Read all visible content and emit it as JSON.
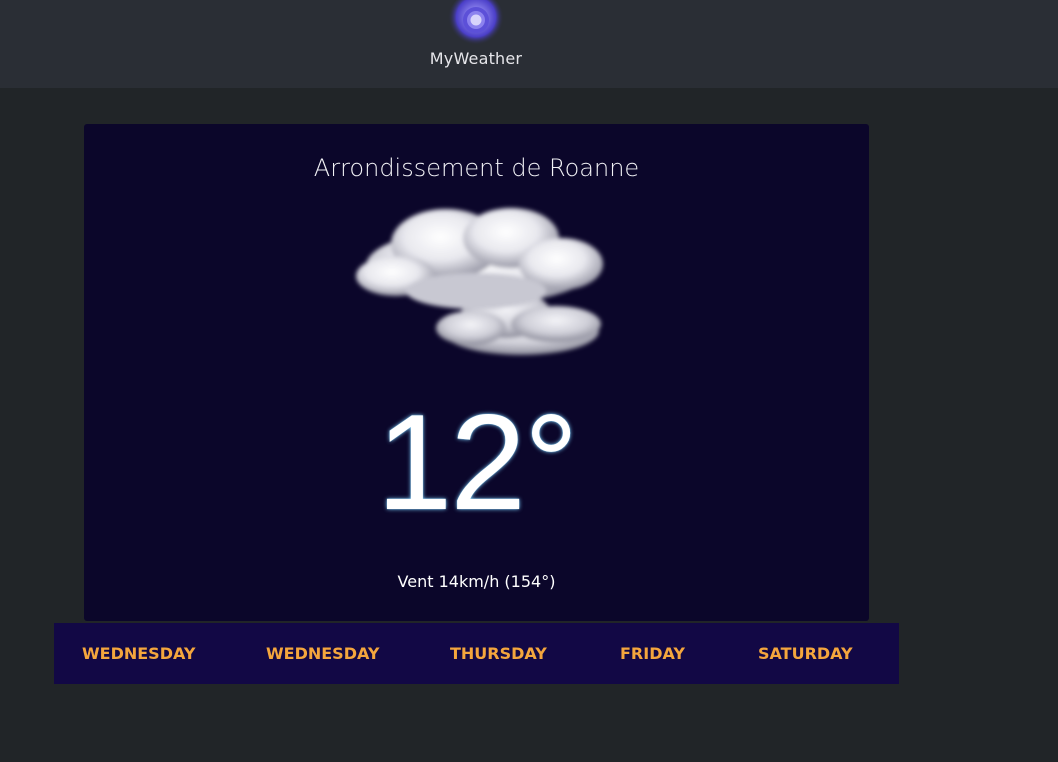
{
  "header": {
    "app_name": "MyWeather",
    "logo_icon": "weather-orb-icon"
  },
  "weather": {
    "city": "Arrondissement de Roanne",
    "condition_icon": "clouds-icon",
    "temperature": "12°",
    "wind": "Vent 14km/h (154°)"
  },
  "forecast": {
    "days": [
      {
        "label": "WEDNESDAY"
      },
      {
        "label": "WEDNESDAY"
      },
      {
        "label": "THURSDAY"
      },
      {
        "label": "FRIDAY"
      },
      {
        "label": "SATURDAY"
      }
    ]
  },
  "colors": {
    "page_bg": "#212528",
    "header_bg": "#2a2e35",
    "card_bg": "#0b062a",
    "forecast_bg": "#120845",
    "day_label": "#f4a63d"
  }
}
